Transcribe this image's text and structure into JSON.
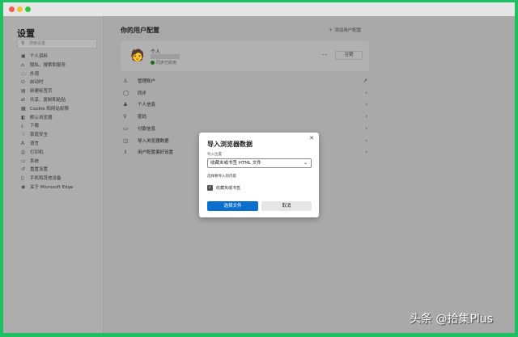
{
  "window": {
    "traffic_lights": [
      "#f25e57",
      "#f5bd2f",
      "#2bc840"
    ]
  },
  "sidebar": {
    "title": "设置",
    "search_placeholder": "搜索设置",
    "items": [
      {
        "label": "个人资料",
        "icon": "person-icon"
      },
      {
        "label": "隐私、搜索和服务",
        "icon": "lock-icon"
      },
      {
        "label": "外观",
        "icon": "palette-icon"
      },
      {
        "label": "启动时",
        "icon": "power-icon"
      },
      {
        "label": "新建标签页",
        "icon": "tab-icon"
      },
      {
        "label": "共享、复制和粘贴",
        "icon": "share-icon"
      },
      {
        "label": "Cookie 和网站权限",
        "icon": "cookie-icon"
      },
      {
        "label": "默认浏览器",
        "icon": "browser-icon"
      },
      {
        "label": "下载",
        "icon": "download-icon"
      },
      {
        "label": "家庭安全",
        "icon": "family-icon"
      },
      {
        "label": "语言",
        "icon": "language-icon"
      },
      {
        "label": "打印机",
        "icon": "printer-icon"
      },
      {
        "label": "系统",
        "icon": "system-icon"
      },
      {
        "label": "重置设置",
        "icon": "reset-icon"
      },
      {
        "label": "手机和其他设备",
        "icon": "phone-icon"
      },
      {
        "label": "关于 Microsoft Edge",
        "icon": "edge-icon"
      }
    ]
  },
  "main": {
    "title": "你的用户配置",
    "add_profile": "添加用户配置",
    "profile": {
      "name": "个人",
      "sync_status": "同步已启用",
      "more": "···",
      "signout": "注销"
    },
    "rows": [
      {
        "label": "管理账户"
      },
      {
        "label": "同步"
      },
      {
        "label": "个人信息"
      },
      {
        "label": "密码"
      },
      {
        "label": "付款信息"
      },
      {
        "label": "导入浏览器数据"
      },
      {
        "label": "用户配置偏好设置"
      }
    ]
  },
  "dialog": {
    "title": "导入浏览器数据",
    "import_from_label": "导入位置",
    "import_from_value": "收藏夹或书签 HTML 文件",
    "choose_label": "选择要导入的内容",
    "checkbox_label": "收藏夹或书签",
    "primary": "选择文件",
    "cancel": "取消"
  },
  "watermark": "头条 @拾集Plus"
}
